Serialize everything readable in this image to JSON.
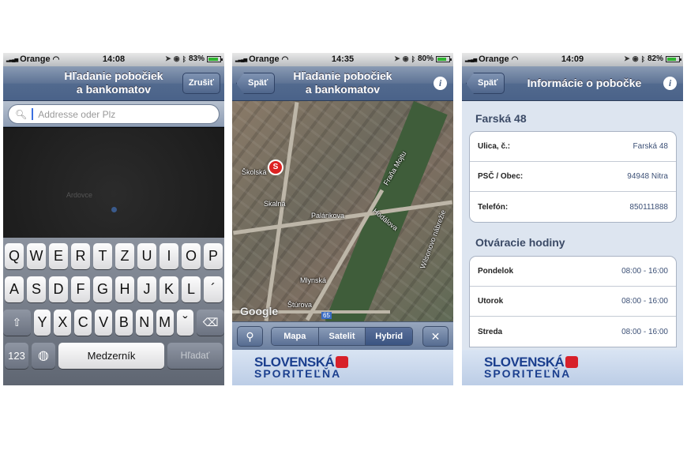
{
  "status": {
    "carrier": "Orange",
    "screens": [
      {
        "time": "14:08",
        "battery": "83%",
        "battery_level": 0.83
      },
      {
        "time": "14:35",
        "battery": "80%",
        "battery_level": 0.8
      },
      {
        "time": "14:09",
        "battery": "82%",
        "battery_level": 0.82
      }
    ]
  },
  "screen1": {
    "title_line1": "Hľadanie pobočiek",
    "title_line2": "a bankomatov",
    "button": "Zrušiť",
    "search_placeholder": "Addresse oder Plz",
    "map_town": "Ardovce",
    "keyboard": {
      "row1": [
        "Q",
        "W",
        "E",
        "R",
        "T",
        "Z",
        "U",
        "I",
        "O",
        "P"
      ],
      "row2": [
        "A",
        "S",
        "D",
        "F",
        "G",
        "H",
        "J",
        "K",
        "L",
        "´"
      ],
      "row3": [
        "Y",
        "X",
        "C",
        "V",
        "B",
        "N",
        "M",
        "ˇ"
      ],
      "num": "123",
      "space": "Medzerník",
      "action": "Hľadať"
    }
  },
  "screen2": {
    "title_line1": "Hľadanie pobočiek",
    "title_line2": "a bankomatov",
    "back": "Späť",
    "map_labels": {
      "street1": "Školská",
      "street2": "Skalná",
      "street3": "Palárikova",
      "street4": "Hodálova",
      "street5": "Mlynská",
      "street6": "Štúrova",
      "street7": "Fraňa Mojtu",
      "street8": "Wilsonovo nábrežie",
      "google": "Google",
      "road": "65"
    },
    "segments": [
      "Mapa",
      "Satelit",
      "Hybrid"
    ],
    "active_segment": "Hybrid"
  },
  "screen3": {
    "back": "Späť",
    "title": "Informácie o pobočke",
    "branch_name": "Farská 48",
    "address_rows": [
      {
        "label": "Ulica, č.:",
        "value": "Farská 48"
      },
      {
        "label": "PSČ / Obec:",
        "value": "94948 Nitra"
      },
      {
        "label": "Telefón:",
        "value": "850111888"
      }
    ],
    "hours_title": "Otváracie hodiny",
    "hours_rows": [
      {
        "label": "Pondelok",
        "value": "08:00 - 16:00"
      },
      {
        "label": "Utorok",
        "value": "08:00 - 16:00"
      },
      {
        "label": "Streda",
        "value": "08:00 - 16:00"
      }
    ]
  },
  "logo": {
    "line1": "SLOVENSKÁ",
    "line2": "SPORITEĽŇA"
  },
  "colors": {
    "navbar": "#526a8e",
    "logo_blue": "#1b3f8e",
    "logo_red": "#d7202a"
  }
}
